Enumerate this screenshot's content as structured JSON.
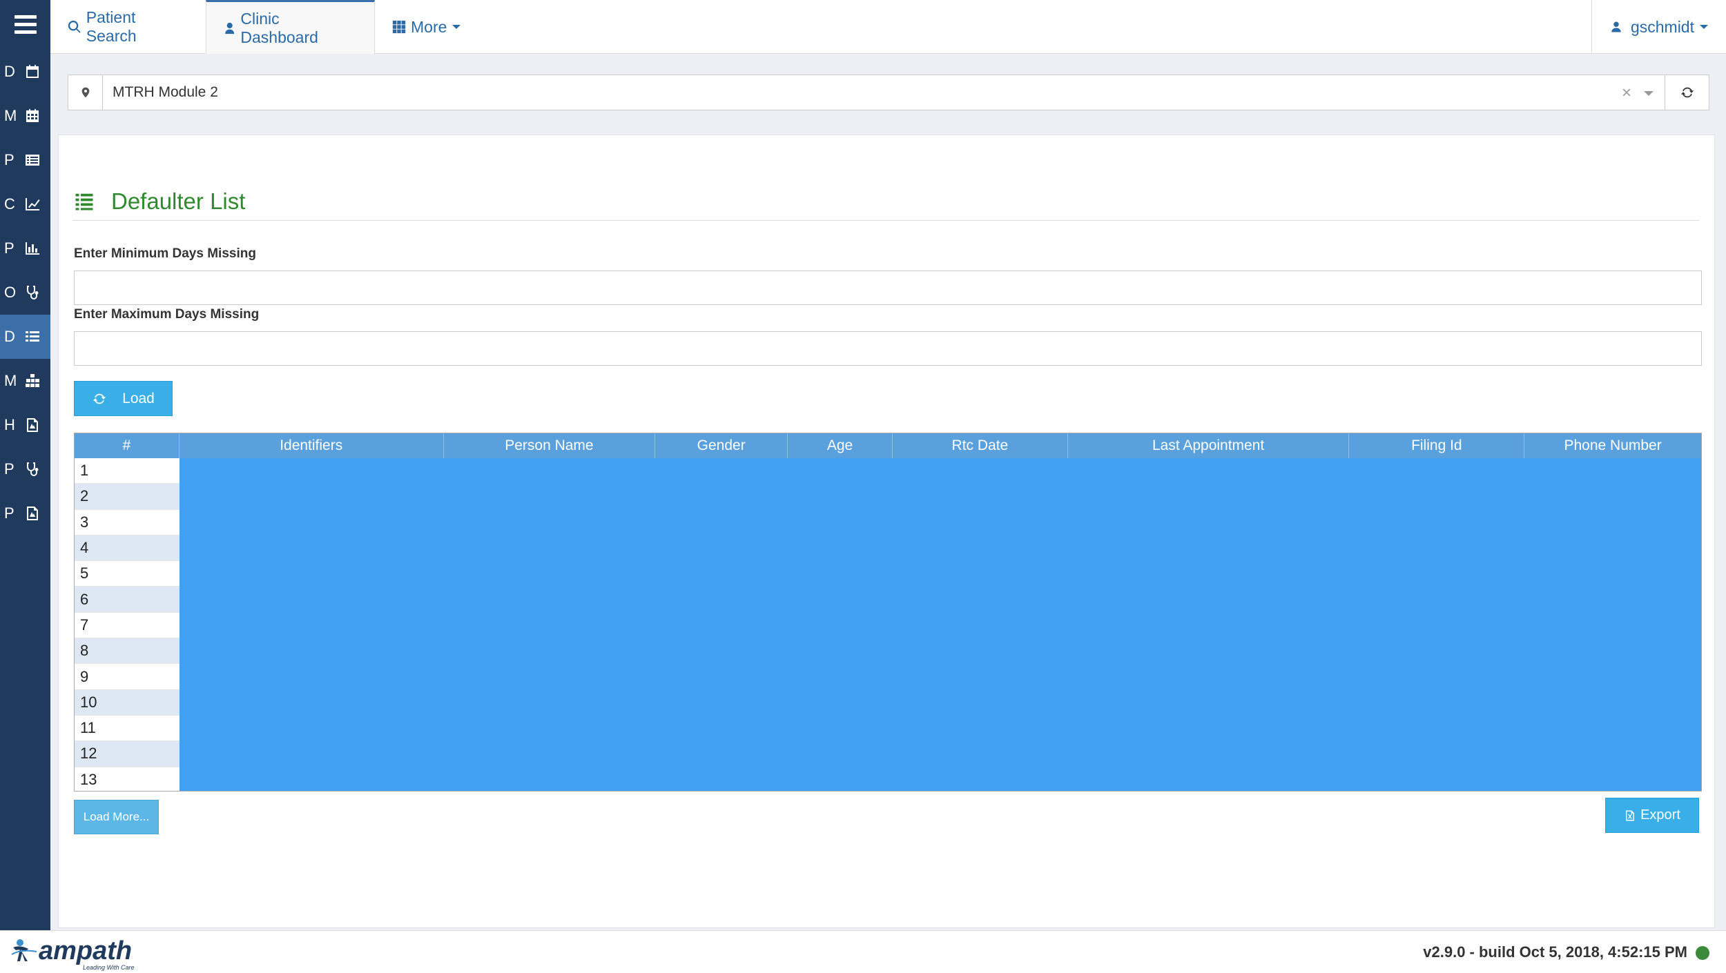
{
  "nav": {
    "patient_search": "Patient Search",
    "clinic_dashboard": "Clinic Dashboard",
    "more": "More",
    "user": "gschmidt"
  },
  "sidebar": {
    "items": [
      {
        "letter": "D",
        "icon": "calendar-icon"
      },
      {
        "letter": "M",
        "icon": "calendar-grid-icon"
      },
      {
        "letter": "P",
        "icon": "list-alt-icon"
      },
      {
        "letter": "C",
        "icon": "line-chart-icon"
      },
      {
        "letter": "P",
        "icon": "bar-chart-icon"
      },
      {
        "letter": "O",
        "icon": "stethoscope-icon"
      },
      {
        "letter": "D",
        "icon": "list-icon"
      },
      {
        "letter": "M",
        "icon": "cubes-icon"
      },
      {
        "letter": "H",
        "icon": "pdf-file-icon"
      },
      {
        "letter": "P",
        "icon": "stethoscope-icon"
      },
      {
        "letter": "P",
        "icon": "pdf-file-icon"
      }
    ]
  },
  "location": {
    "value": "MTRH Module 2",
    "clear": "×"
  },
  "page": {
    "title": "Defaulter List",
    "min_label": "Enter Minimum Days Missing",
    "max_label": "Enter Maximum Days Missing",
    "load_button": "Load",
    "load_more_button": "Load More...",
    "export_button": "Export"
  },
  "grid": {
    "columns": [
      "#",
      "Identifiers",
      "Person Name",
      "Gender",
      "Age",
      "Rtc Date",
      "Last Appointment",
      "Filing Id",
      "Phone Number"
    ],
    "rows": [
      "1",
      "2",
      "3",
      "4",
      "5",
      "6",
      "7",
      "8",
      "9",
      "10",
      "11",
      "12",
      "13"
    ]
  },
  "footer": {
    "logo": "ampath",
    "tagline": "Leading With Care",
    "version": "v2.9.0 - build Oct 5, 2018, 4:52:15 PM"
  },
  "colors": {
    "sidebar": "#1f3a5c",
    "accent": "#3aaee6",
    "title_green": "#2f8a2f",
    "grid_fill": "#42a0f2"
  }
}
